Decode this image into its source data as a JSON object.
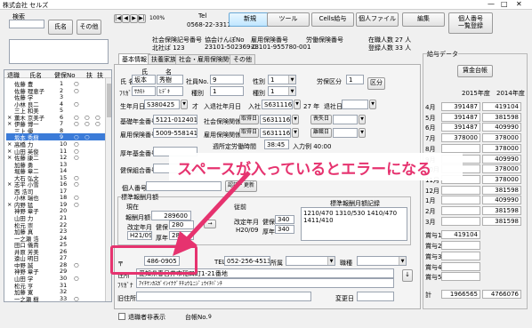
{
  "window": {
    "title": "株式会社 セルズ"
  },
  "left": {
    "search_label": "検索",
    "name_button": "氏名",
    "other_button": "その他",
    "headers": {
      "retired": "退職",
      "name": "氏名",
      "insured": "健保No",
      "nb": "扶"
    },
    "rows": [
      {
        "mark": "",
        "name": "佐藤 豊",
        "no": "1",
        "n1": "○",
        "n2": "",
        "n3": ""
      },
      {
        "mark": "",
        "name": "佐藤 理恵子",
        "no": "2",
        "n1": "○",
        "n2": "",
        "n3": ""
      },
      {
        "mark": "",
        "name": "佐藤 学",
        "no": "3",
        "n1": "",
        "n2": "",
        "n3": ""
      },
      {
        "mark": "",
        "name": "小林 良二",
        "no": "4",
        "n1": "○",
        "n2": "",
        "n3": ""
      },
      {
        "mark": "",
        "name": "三上 和美",
        "no": "5",
        "n1": "",
        "n2": "",
        "n3": ""
      },
      {
        "mark": "×",
        "name": "薫木 京美子",
        "no": "6",
        "n1": "○",
        "n2": "○",
        "n3": "○"
      },
      {
        "mark": "×",
        "name": "伊藤 博一",
        "no": "7",
        "n1": "○",
        "n2": "○",
        "n3": "○"
      },
      {
        "mark": "",
        "name": "三上 優",
        "no": "8",
        "n1": "",
        "n2": "",
        "n3": ""
      },
      {
        "mark": "",
        "name": "坂本 秀樹",
        "no": "9",
        "n1": "○",
        "n2": "○",
        "n3": ""
      },
      {
        "mark": "×",
        "name": "高橋 力",
        "no": "10",
        "n1": "○",
        "n2": "",
        "n3": ""
      },
      {
        "mark": "×",
        "name": "山田 英俊",
        "no": "11",
        "n1": "○",
        "n2": "",
        "n3": ""
      },
      {
        "mark": "×",
        "name": "佐藤 康二",
        "no": "12",
        "n1": "○",
        "n2": "",
        "n3": ""
      },
      {
        "mark": "",
        "name": "加藤 勇",
        "no": "13",
        "n1": "",
        "n2": "",
        "n3": ""
      },
      {
        "mark": "",
        "name": "堀藤 章二",
        "no": "14",
        "n1": "",
        "n2": "",
        "n3": ""
      },
      {
        "mark": "",
        "name": "大石 弘文",
        "no": "15",
        "n1": "○",
        "n2": "",
        "n3": ""
      },
      {
        "mark": "×",
        "name": "志平 小雪",
        "no": "16",
        "n1": "○",
        "n2": "",
        "n3": ""
      },
      {
        "mark": "",
        "name": "西 浩司",
        "no": "17",
        "n1": "",
        "n2": "",
        "n3": ""
      },
      {
        "mark": "",
        "name": "小林 瑞也",
        "no": "18",
        "n1": "○",
        "n2": "",
        "n3": ""
      },
      {
        "mark": "×",
        "name": "内野 猛",
        "no": "19",
        "n1": "○",
        "n2": "",
        "n3": ""
      },
      {
        "mark": "",
        "name": "神野 章子",
        "no": "20",
        "n1": "",
        "n2": "",
        "n3": ""
      },
      {
        "mark": "",
        "name": "山田 力",
        "no": "21",
        "n1": "",
        "n2": "",
        "n3": ""
      },
      {
        "mark": "",
        "name": "松元 崇",
        "no": "22",
        "n1": "",
        "n2": "",
        "n3": ""
      },
      {
        "mark": "",
        "name": "加藤 真",
        "no": "23",
        "n1": "",
        "n2": "",
        "n3": ""
      },
      {
        "mark": "",
        "name": "一之瀬 浩",
        "no": "24",
        "n1": "",
        "n2": "",
        "n3": ""
      },
      {
        "mark": "",
        "name": "田口 儀貴",
        "no": "25",
        "n1": "",
        "n2": "",
        "n3": ""
      },
      {
        "mark": "",
        "name": "井原 芳美",
        "no": "26",
        "n1": "",
        "n2": "",
        "n3": ""
      },
      {
        "mark": "",
        "name": "遠山 明日",
        "no": "27",
        "n1": "",
        "n2": "",
        "n3": ""
      },
      {
        "mark": "",
        "name": "中野 誠",
        "no": "28",
        "n1": "○",
        "n2": "",
        "n3": ""
      },
      {
        "mark": "",
        "name": "神野 章子",
        "no": "29",
        "n1": "",
        "n2": "",
        "n3": ""
      },
      {
        "mark": "",
        "name": "山田 学",
        "no": "30",
        "n1": "○",
        "n2": "",
        "n3": ""
      },
      {
        "mark": "",
        "name": "松元 亨",
        "no": "31",
        "n1": "",
        "n2": "",
        "n3": ""
      },
      {
        "mark": "",
        "name": "加藤 寛",
        "no": "32",
        "n1": "",
        "n2": "",
        "n3": ""
      },
      {
        "mark": "",
        "name": "一之瀬 樹",
        "no": "33",
        "n1": "○",
        "n2": "",
        "n3": ""
      }
    ]
  },
  "toolbar": {
    "zoom": "100%",
    "tel_label": "Tel",
    "tel": "0568-22-3311",
    "new": "新規",
    "tool": "ツール",
    "cells": "Cells給与",
    "personal_file": "個人ファイル",
    "edit": "編集",
    "personal_list": "個人番号\n一覧登録"
  },
  "company": {
    "social_label": "社会保険記号番号",
    "social": "北社ば 123",
    "kyokai_label": "協会けんぽNo",
    "kyokai": "23101-502369-0",
    "employ_label": "雇用保険番号",
    "employ": "23101-955780-001",
    "labor_label": "労働保険番号",
    "labor": "",
    "enrolled_label": "在職人数",
    "enrolled": "27 人",
    "registered_label": "登録人数",
    "registered": "33 人"
  },
  "tabs": [
    "基本情報",
    "扶養家族",
    "社会・雇用保険関係",
    "その他"
  ],
  "form": {
    "name_label": "氏 名",
    "furigana_label": "ﾌﾘｶﾞﾅ",
    "family": "坂本",
    "given": "秀樹",
    "family_label": "氏",
    "given_label": "名",
    "family_kana": "ｻｶﾓﾄ",
    "given_kana": "ﾋﾃﾞｷ",
    "empno_label": "社員No.",
    "empno": "9",
    "kind_label": "種別",
    "kind": "1",
    "sex_label": "性別",
    "sex": "1",
    "labor_label": "労保区分",
    "labor": "1",
    "kubun_button": "区分",
    "birth_label": "生年月日",
    "birth": "S380425",
    "birth_suffix": "才",
    "join_label": "入退社年月日",
    "join_in": "入社",
    "join": "S631116",
    "join_suffix": "27 年",
    "retire_label": "退社日",
    "pension_label": "基礎年金番号",
    "pension": "5121-012401",
    "social_rel_label": "社会保険関係",
    "social_get": "取得日",
    "social_date": "S631116",
    "social_lost": "喪失日",
    "employ_label": "雇用保険番号",
    "employ": "5009-558141-3",
    "employ_rel_label": "雇用保険関係",
    "employ_get": "取得日",
    "employ_date": "S631116",
    "employ_lost": "離職日",
    "work_hours_label": "週所定労働時間",
    "work_hours": "38:45",
    "input_label": "入力例 40:00",
    "welfare_label": "厚年基金番号",
    "health_label": "健保組合番号",
    "mynumber_label": "個人番号",
    "auth_button": "認証・更新",
    "monthly_label": "標準報酬月額",
    "current_label": "現在",
    "salary_label": "報酬月額",
    "salary": "289600",
    "revised_label": "改定年月",
    "revised": "H21/09",
    "kenpo_label": "健保",
    "kenpo": "280",
    "kosei_label": "厚年",
    "kosei": "280",
    "prev_label": "従前",
    "prev_revised": "H20/09",
    "prev_kenpo": "340",
    "prev_kosei": "340",
    "record_label": "標準報酬月額記録",
    "record": "1210/470 1310/530 1410/470\n1411/410",
    "zip_label": "〒",
    "zip": "486-0905",
    "tel_label": "TEL",
    "tel": "052-256-4513",
    "belong_label": "所属",
    "post_label": "職種",
    "address_label": "住所",
    "address": "愛知県春日井市稲口町1-21番地",
    "address_kana": "ｱｲﾁｹﾝｶｽｶﾞｲｼｲﾅｸﾞﾁﾁｮｳ1ﾆｼﾞｭｳｲﾁﾊﾞﾝﾁ",
    "old_address_label": "旧住所",
    "change_label": "変更日"
  },
  "salary": {
    "group": "給与データ",
    "ledger_button": "賃金台帳",
    "year1": "2015年度",
    "year2": "2014年度",
    "months": [
      {
        "m": "4月",
        "a": "391487",
        "b": "419104"
      },
      {
        "m": "5月",
        "a": "391487",
        "b": "381598"
      },
      {
        "m": "6月",
        "a": "391487",
        "b": "409990"
      },
      {
        "m": "7月",
        "a": "378000",
        "b": "378000"
      },
      {
        "m": "8月",
        "a": "",
        "b": "378000"
      },
      {
        "m": "9月",
        "a": "",
        "b": "409990"
      },
      {
        "m": "10月",
        "a": "",
        "b": "378000"
      },
      {
        "m": "11月",
        "a": "",
        "b": "378000"
      },
      {
        "m": "12月",
        "a": "",
        "b": "381598"
      },
      {
        "m": "1月",
        "a": "",
        "b": "409990"
      },
      {
        "m": "2月",
        "a": "",
        "b": "381598"
      },
      {
        "m": "3月",
        "a": "",
        "b": "381598"
      },
      {
        "m": "賞与1",
        "a": "419104",
        "b": ""
      },
      {
        "m": "賞与2",
        "a": "",
        "b": ""
      },
      {
        "m": "賞与3",
        "a": "",
        "b": ""
      },
      {
        "m": "賞与4",
        "a": "",
        "b": ""
      },
      {
        "m": "賞与5",
        "a": "",
        "b": ""
      },
      {
        "m": "計",
        "a": "1966565",
        "b": "4766076"
      }
    ]
  },
  "footer": {
    "show_retired": "退職者非表示",
    "ledger_label": "台帳No.",
    "ledger_no": "9"
  },
  "annotation": {
    "text": "スペースが入っているとエラーになる",
    "color": "#e6336f"
  }
}
